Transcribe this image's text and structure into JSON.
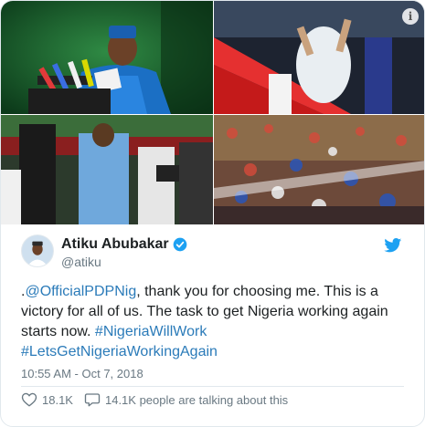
{
  "tweet": {
    "display_name": "Atiku Abubakar",
    "handle": "@atiku",
    "text_prefix": ".",
    "mention": "@OfficialPDPNig",
    "text_body": ", thank you for choosing me. This is a victory for all of us. The task to get Nigeria working again starts now. ",
    "hashtag_1": "#NigeriaWillWork",
    "hashtag_2": "#LetsGetNigeriaWorkingAgain",
    "timestamp": "10:55 AM - Oct 7, 2018",
    "likes": "18.1K",
    "replies_text": "14.1K people are talking about this"
  },
  "colors": {
    "link": "#2b7bb9",
    "twitter_blue": "#1da1f2",
    "muted": "#697882",
    "text": "#1c2022"
  },
  "icons": {
    "info": "info-icon",
    "verified": "verified-badge-icon",
    "bird": "twitter-bird-icon",
    "like": "heart-icon",
    "reply": "speech-bubble-icon"
  }
}
